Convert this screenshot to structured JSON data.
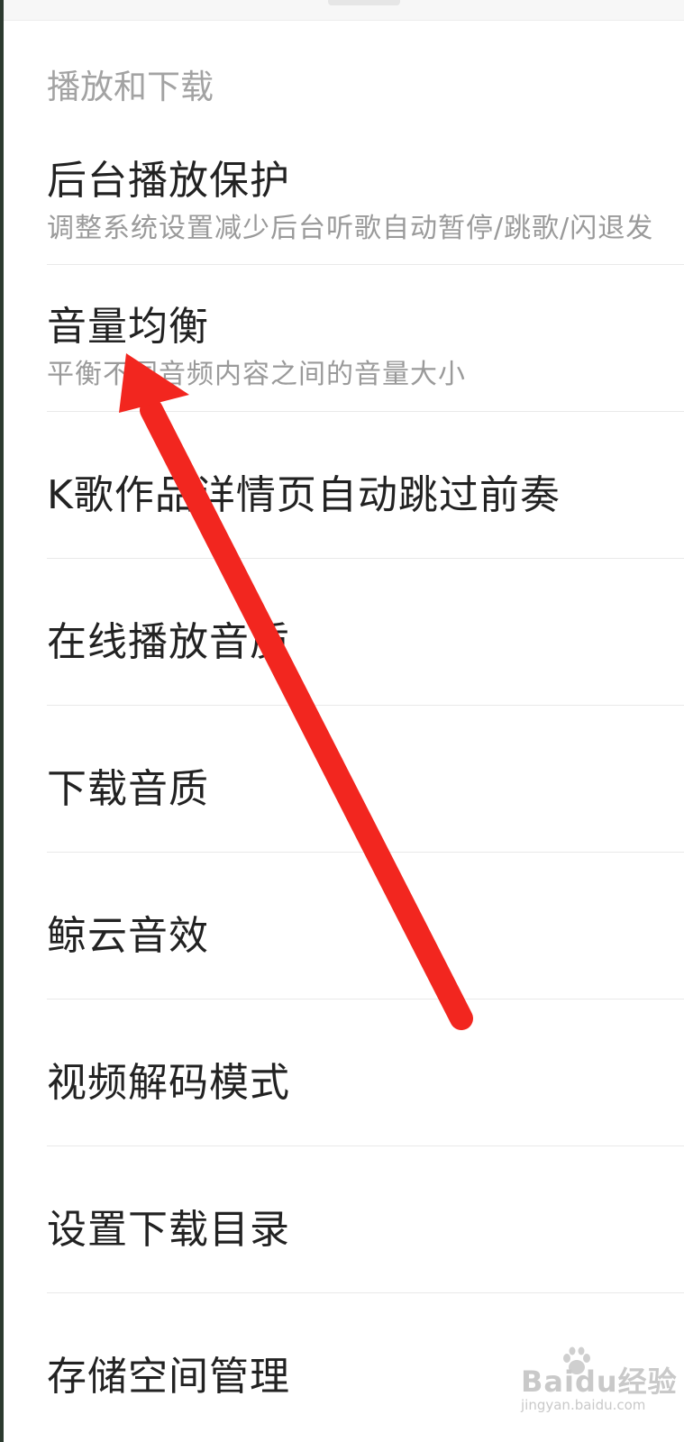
{
  "section_header": "播放和下载",
  "items": [
    {
      "title": "后台播放保护",
      "subtitle": "调整系统设置减少后台听歌自动暂停/跳歌/闪退发"
    },
    {
      "title": "音量均衡",
      "subtitle": "平衡不同音频内容之间的音量大小"
    },
    {
      "title": "K歌作品详情页自动跳过前奏"
    },
    {
      "title": "在线播放音质"
    },
    {
      "title": "下载音质"
    },
    {
      "title": "鲸云音效"
    },
    {
      "title": "视频解码模式"
    },
    {
      "title": "设置下载目录"
    },
    {
      "title": "存储空间管理"
    }
  ],
  "annotation": {
    "type": "arrow",
    "color": "#f2261f"
  },
  "watermark": {
    "logo": "Baidu经验",
    "url": "jingyan.baidu.com"
  }
}
